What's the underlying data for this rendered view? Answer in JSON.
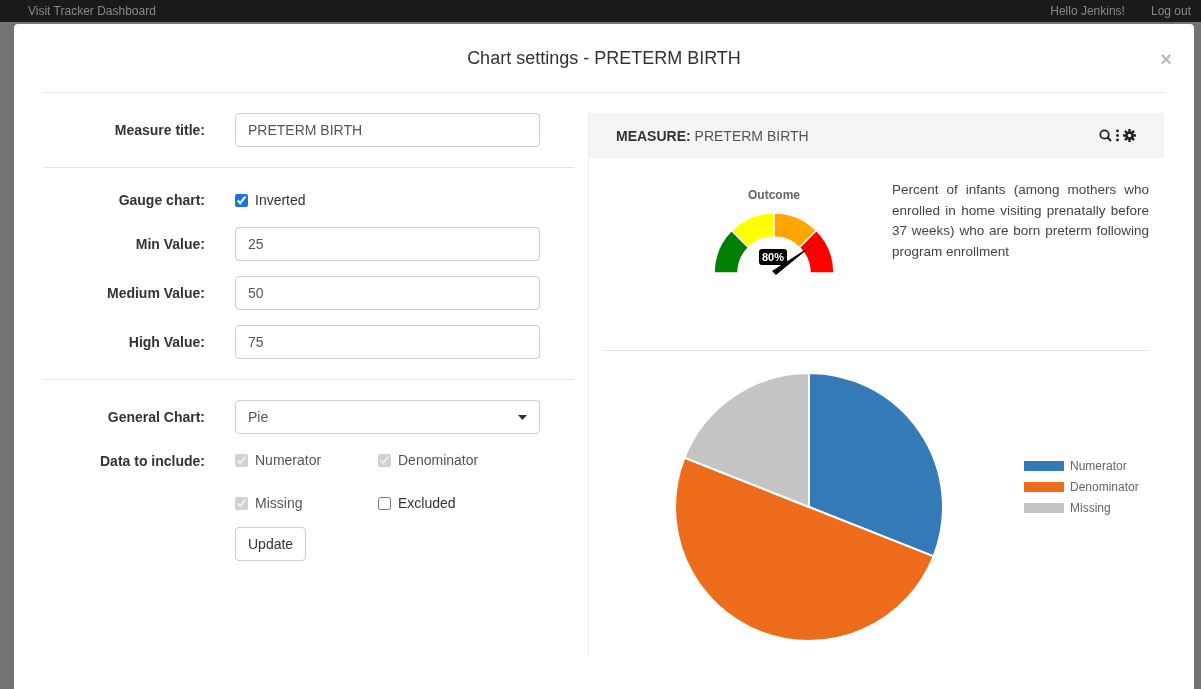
{
  "background_nav": {
    "title": "Visit Tracker Dashboard",
    "greeting": "Hello Jenkins!",
    "logout": "Log out"
  },
  "modal": {
    "title": "Chart settings - PRETERM BIRTH",
    "close": "×"
  },
  "form": {
    "measure_title": {
      "label": "Measure title:",
      "value": "PRETERM BIRTH"
    },
    "gauge": {
      "label": "Gauge chart:",
      "option": "Inverted",
      "checked": true
    },
    "values": [
      {
        "label": "Min Value:",
        "value": "25"
      },
      {
        "label": "Medium Value:",
        "value": "50"
      },
      {
        "label": "High Value:",
        "value": "75"
      }
    ],
    "general_chart": {
      "label": "General Chart:",
      "value": "Pie"
    },
    "data_include": {
      "label": "Data to include:",
      "options": [
        {
          "label": "Numerator",
          "checked": true,
          "disabled": true
        },
        {
          "label": "Denominator",
          "checked": true,
          "disabled": true
        },
        {
          "label": "Missing",
          "checked": true,
          "disabled": true
        },
        {
          "label": "Excluded",
          "checked": false,
          "disabled": false
        }
      ]
    },
    "update_button": "Update"
  },
  "preview": {
    "header_label": "MEASURE:",
    "header_value": "PRETERM BIRTH",
    "gauge": {
      "title": "Outcome",
      "reading": "80%",
      "level": 0.8
    },
    "description": "Percent of infants (among mothers who enrolled in home visiting prenatally before 37 weeks) who are born preterm following program enrollment",
    "legend": [
      {
        "label": "Numerator",
        "color": "#337ab7"
      },
      {
        "label": "Denominator",
        "color": "#ed6c1b"
      },
      {
        "label": "Missing",
        "color": "#c4c4c4"
      }
    ]
  }
}
